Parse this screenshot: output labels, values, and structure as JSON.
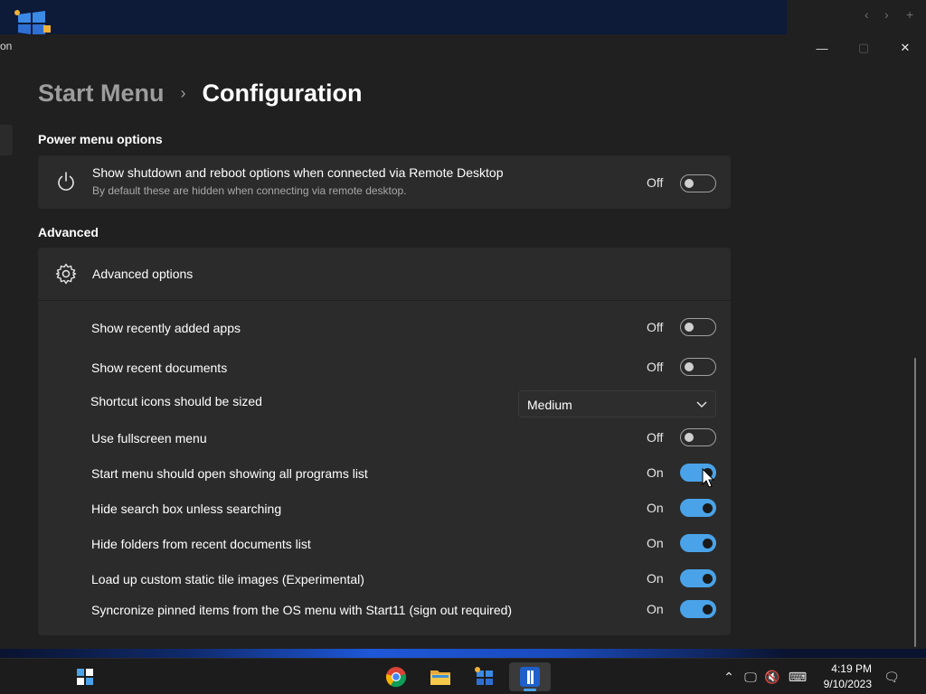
{
  "window": {
    "left_fragment": "on",
    "controls": {
      "minimize": "—",
      "maximize": "▢",
      "close": "✕"
    }
  },
  "breadcrumb": {
    "parent": "Start Menu",
    "separator": "›",
    "current": "Configuration"
  },
  "power_section": {
    "title": "Power menu options",
    "card": {
      "title": "Show shutdown and reboot options when connected via Remote Desktop",
      "description": "By default these are hidden when connecting via remote desktop.",
      "state": "Off"
    }
  },
  "advanced_section": {
    "title": "Advanced",
    "header": "Advanced options",
    "rows": [
      {
        "label": "Show recently added apps",
        "state": "Off"
      },
      {
        "label": "Show recent documents",
        "state": "Off"
      },
      {
        "label": "Shortcut icons should be sized",
        "dropdown": "Medium"
      },
      {
        "label": "Use fullscreen menu",
        "state": "Off"
      },
      {
        "label": "Start menu should open showing all programs list",
        "state": "On"
      },
      {
        "label": "Hide search box unless searching",
        "state": "On"
      },
      {
        "label": "Hide folders from recent documents list",
        "state": "On"
      },
      {
        "label": "Load up custom static tile images (Experimental)",
        "state": "On"
      },
      {
        "label": "Syncronize pinned items from the OS menu with Start11 (sign out required)",
        "state": "On"
      }
    ]
  },
  "taskbar": {
    "apps": [
      "start-button",
      "chrome",
      "file-explorer",
      "start11-config",
      "stardock-app"
    ],
    "clock_time": "4:19 PM",
    "clock_date": "9/10/2023"
  },
  "colors": {
    "accent": "#4aa3e8",
    "card": "#2b2b2b",
    "window": "#202020"
  }
}
